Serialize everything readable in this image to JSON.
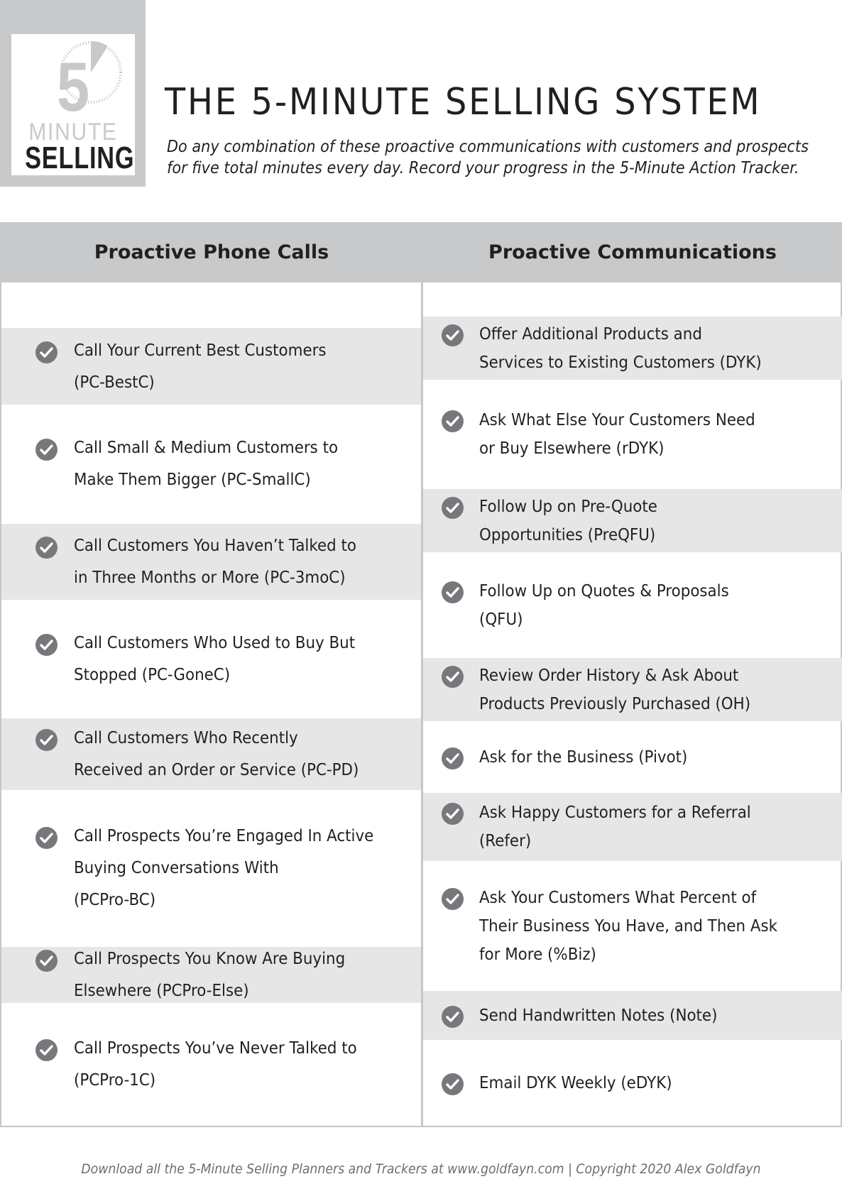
{
  "logo": {
    "number": "5",
    "word_top": "MINUTE",
    "word_bottom": "SELLING"
  },
  "header": {
    "title": "THE 5-MINUTE SELLING SYSTEM",
    "subtitle_line1": "Do any combination of these proactive communications with customers and prospects",
    "subtitle_line2": "for five total minutes every day. Record your progress in the 5-Minute Action Tracker."
  },
  "table": {
    "columns": [
      {
        "heading": "Proactive Phone Calls",
        "items": [
          {
            "lines": [
              "Call Your Current Best Customers",
              "(PC-BestC)"
            ],
            "icon": "check-circle-icon"
          },
          {
            "lines": [
              "Call Small & Medium  Customers to",
              "Make Them Bigger (PC-SmallC)"
            ],
            "icon": "check-circle-icon"
          },
          {
            "lines": [
              "Call Customers You Haven’t Talked to",
              "in Three Months or More (PC-3moC)"
            ],
            "icon": "check-circle-icon"
          },
          {
            "lines": [
              "Call Customers Who Used to Buy But",
              "Stopped (PC-GoneC)"
            ],
            "icon": "check-circle-icon"
          },
          {
            "lines": [
              "Call Customers Who Recently",
              "Received an Order or Service (PC-PD)"
            ],
            "icon": "check-circle-icon"
          },
          {
            "lines": [
              "Call Prospects You’re Engaged In Active",
              "Buying Conversations With",
              "(PCPro-BC)"
            ],
            "icon": "check-circle-icon"
          },
          {
            "lines": [
              "Call Prospects You Know Are Buying",
              "Elsewhere (PCPro-Else)"
            ],
            "icon": "check-circle-icon"
          },
          {
            "lines": [
              "Call Prospects You’ve Never Talked to",
              "(PCPro-1C)"
            ],
            "icon": "check-circle-icon"
          }
        ]
      },
      {
        "heading": "Proactive Communications",
        "items": [
          {
            "lines": [
              "Offer Additional Products and",
              "Services to Existing Customers (DYK)"
            ],
            "icon": "check-circle-icon"
          },
          {
            "lines": [
              "Ask What Else Your Customers Need",
              "or Buy Elsewhere (rDYK)"
            ],
            "icon": "check-circle-icon"
          },
          {
            "lines": [
              "Follow Up on Pre-Quote",
              "Opportunities (PreQFU)"
            ],
            "icon": "check-circle-icon"
          },
          {
            "lines": [
              "Follow Up on Quotes & Proposals",
              "(QFU)"
            ],
            "icon": "check-circle-icon"
          },
          {
            "lines": [
              "Review Order History & Ask About",
              "Products Previously Purchased (OH)"
            ],
            "icon": "check-circle-icon"
          },
          {
            "lines": [
              "Ask for the Business (Pivot)"
            ],
            "icon": "check-circle-icon"
          },
          {
            "lines": [
              "Ask Happy Customers for a Referral",
              "(Refer)"
            ],
            "icon": "check-circle-icon"
          },
          {
            "lines": [
              "Ask Your Customers What Percent of",
              "Their Business You Have, and Then Ask",
              "for More (%Biz)"
            ],
            "icon": "check-circle-icon"
          },
          {
            "lines": [
              "Send Handwritten Notes (Note)"
            ],
            "icon": "check-circle-icon"
          },
          {
            "lines": [
              "Email DYK Weekly (eDYK)"
            ],
            "icon": "check-circle-icon"
          }
        ]
      }
    ]
  },
  "footer": {
    "text": "Download all the 5-Minute Selling Planners and Trackers at www.goldfayn.com  |  Copyright 2020 Alex Goldfayn"
  },
  "colors": {
    "header_band": "#c8c9cb",
    "row_shade": "#e6e6e7",
    "check_icon": "#77787b",
    "text": "#231f20",
    "footer_text": "#6d6e71"
  }
}
